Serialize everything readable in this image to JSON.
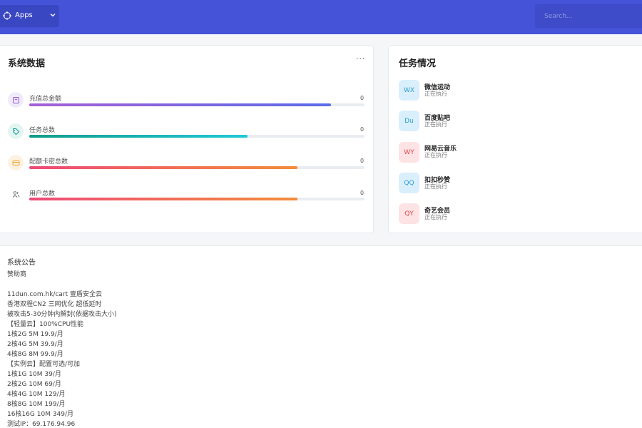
{
  "header": {
    "apps_label": "Apps",
    "search_placeholder": "Search..."
  },
  "system_card": {
    "title": "系统数据",
    "more": "···",
    "stats": [
      {
        "label": "充值总金额",
        "value": "0",
        "fill_percent": 90,
        "icon": "bag-icon",
        "gradient": [
          "#a65fd6",
          "#5b6ce8"
        ],
        "icon_color": "#8e5ad3",
        "icon_bg": "#f1eafb"
      },
      {
        "label": "任务总数",
        "value": "0",
        "fill_percent": 65,
        "icon": "tag-icon",
        "gradient": [
          "#109b8a",
          "#22c8d8"
        ],
        "icon_color": "#159a8c",
        "icon_bg": "#e3f5f2"
      },
      {
        "label": "配额卡密总数",
        "value": "0",
        "fill_percent": 80,
        "icon": "card-icon",
        "gradient": [
          "#ee4a78",
          "#f28d3a"
        ],
        "icon_color": "#f0a436",
        "icon_bg": "#fdf2e1"
      },
      {
        "label": "用户总数",
        "value": "0",
        "fill_percent": 80,
        "icon": "users-icon",
        "gradient": [
          "#ee4a78",
          "#f28d3a"
        ],
        "icon_color": "#666",
        "icon_bg": "#ffffff"
      }
    ]
  },
  "task_card": {
    "title": "任务情况",
    "items": [
      {
        "abbr": "WX",
        "name": "微信运动",
        "status": "正在执行",
        "color": "#2d9ed6",
        "bg": "#d9effb"
      },
      {
        "abbr": "Du",
        "name": "百度贴吧",
        "status": "正在执行",
        "color": "#2d9ed6",
        "bg": "#d9effb"
      },
      {
        "abbr": "WY",
        "name": "网易云音乐",
        "status": "正在执行",
        "color": "#e0474f",
        "bg": "#fde3e4"
      },
      {
        "abbr": "QQ",
        "name": "扣扣秒赞",
        "status": "正在执行",
        "color": "#2d9ed6",
        "bg": "#d9effb"
      },
      {
        "abbr": "QY",
        "name": "奇艺会员",
        "status": "正在执行",
        "color": "#e0474f",
        "bg": "#fde3e4"
      }
    ]
  },
  "notice": {
    "title": "系统公告",
    "lines": [
      "赞助商",
      "",
      "11dun.com.hk/cart 壹盾安全云",
      "香港双程CN2 三网优化 超低延时",
      "被攻击5-30分钟内解封(依据攻击大小)",
      "【轻量云】100%CPU性能",
      "1核2G 5M 19.9/月",
      "2核4G 5M 39.9/月",
      "4核8G 8M 99.9/月",
      "【实例云】配置可选/可加",
      "1核1G 10M 39/月",
      "2核2G 10M 69/月",
      "4核4G 10M 129/月",
      "8核8G 10M 199/月",
      "16核16G 10M 349/月",
      "测试IP：69.176.94.96"
    ]
  }
}
